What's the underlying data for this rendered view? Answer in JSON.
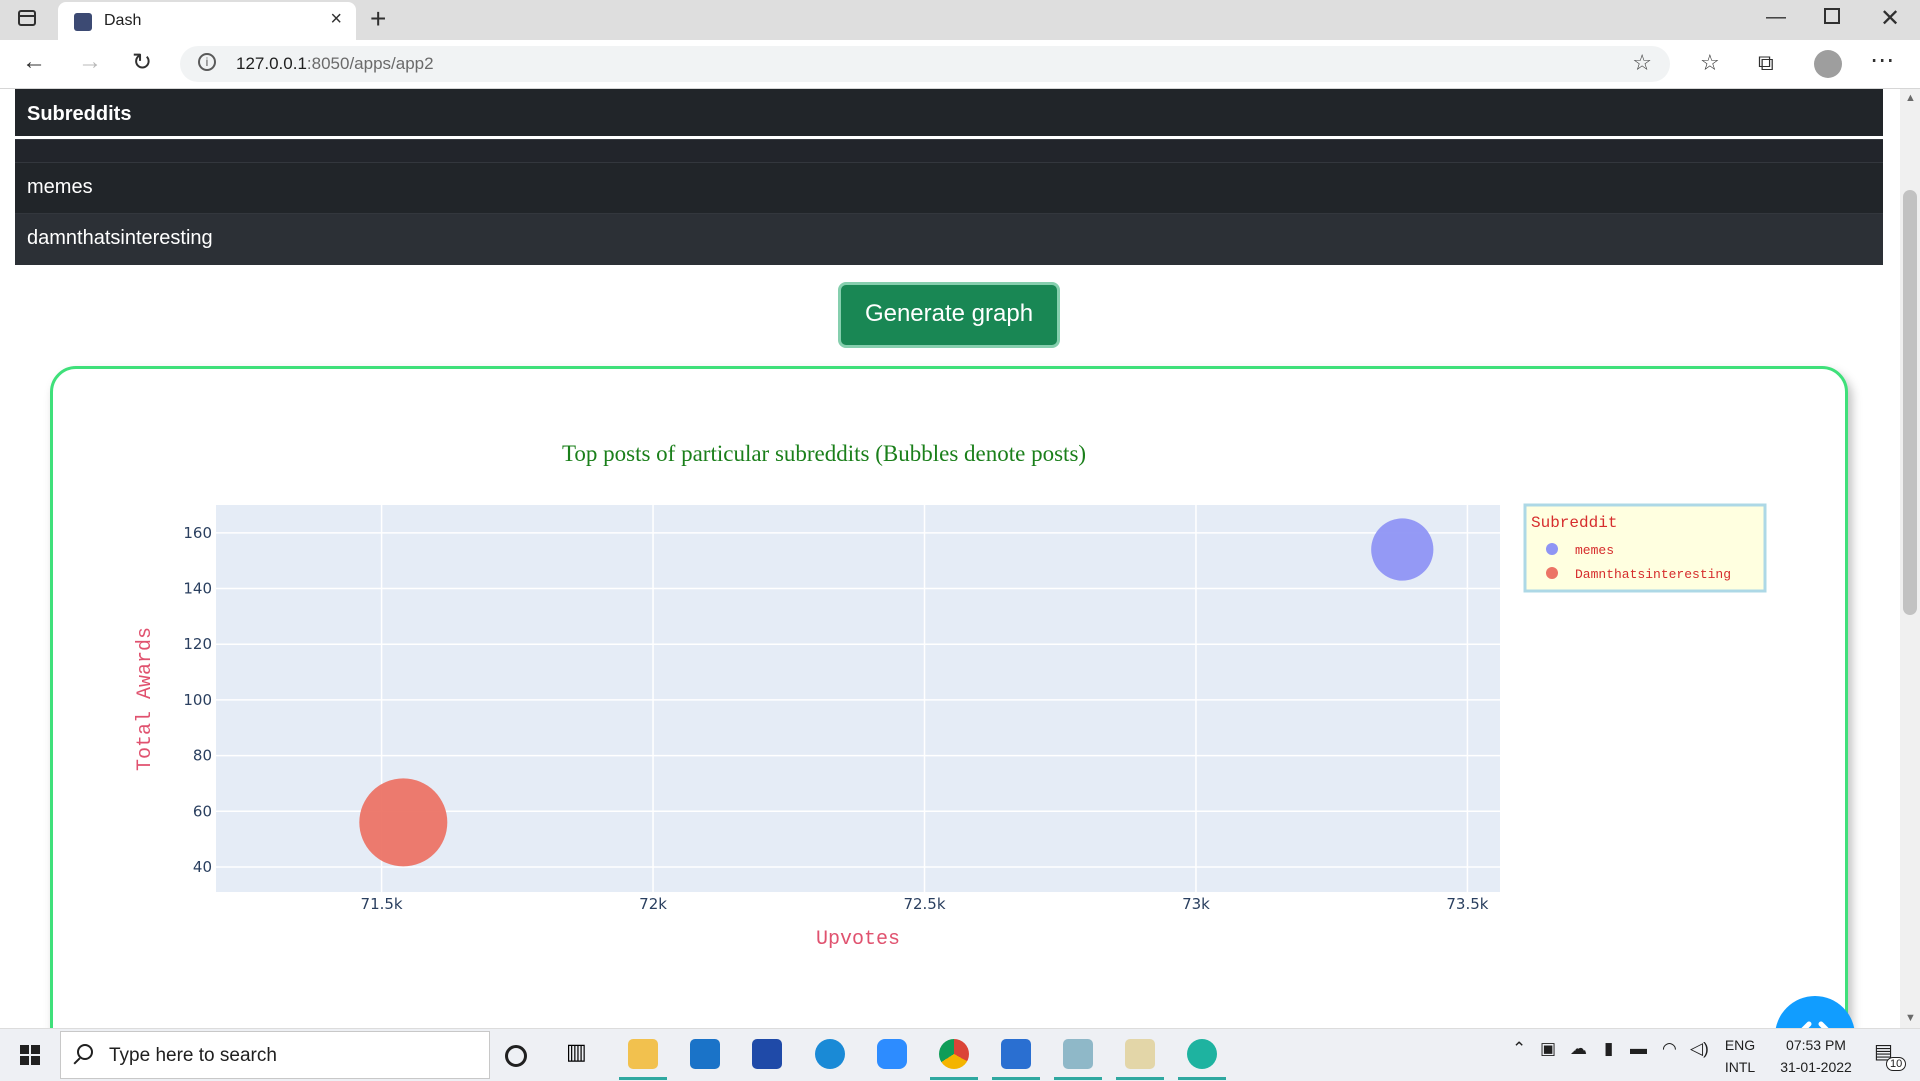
{
  "browser": {
    "tab_title": "Dash",
    "url_host": "127.0.0.1",
    "url_rest": ":8050/apps/app2"
  },
  "table": {
    "header": "Subreddits",
    "rows": [
      "memes",
      "damnthatsinteresting"
    ]
  },
  "button": {
    "label": "Generate graph"
  },
  "chart_data": {
    "type": "scatter",
    "title": "Top posts of particular subreddits (Bubbles denote posts)",
    "xlabel": "Upvotes",
    "ylabel": "Total Awards",
    "xlim": [
      71195,
      73560
    ],
    "ylim": [
      31,
      170
    ],
    "x_ticks": [
      71500,
      72000,
      72500,
      73000,
      73500
    ],
    "x_tick_labels": [
      "71.5k",
      "72k",
      "72.5k",
      "73k",
      "73.5k"
    ],
    "y_ticks": [
      40,
      60,
      80,
      100,
      120,
      140,
      160
    ],
    "y_tick_labels": [
      "40",
      "60",
      "80",
      "100",
      "120",
      "140",
      "160"
    ],
    "grid": true,
    "legend_title": "Subreddit",
    "legend_position": "right",
    "series": [
      {
        "name": "memes",
        "color": "#8f95f4",
        "points": [
          {
            "x": 73380,
            "y": 154,
            "size_rel": 0.5
          }
        ]
      },
      {
        "name": "Damnthatsinteresting",
        "color": "#ec7466",
        "points": [
          {
            "x": 71540,
            "y": 56,
            "size_rel": 1.0
          }
        ]
      }
    ],
    "title_color": "#1a7f1a",
    "axis_label_color": "#e0526f",
    "legend_text_color": "#d62d2d",
    "plot_bg": "#e5ecf6"
  },
  "taskbar": {
    "search_placeholder": "Type here to search",
    "lang_top": "ENG",
    "lang_bottom": "INTL",
    "time": "07:53 PM",
    "date": "31-01-2022",
    "notifications": "10"
  }
}
